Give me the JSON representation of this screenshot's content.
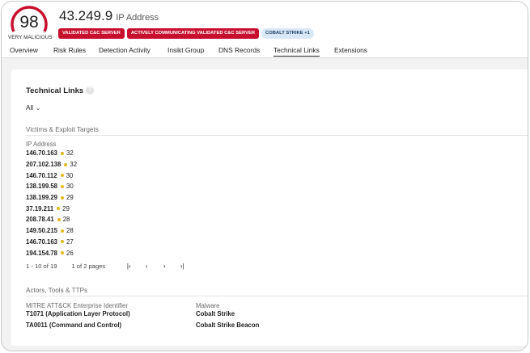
{
  "header": {
    "risk_score": "98",
    "risk_label": "VERY MALICIOUS",
    "entity_value": "43.249.9",
    "entity_type": "IP Address",
    "badges": [
      "VALIDATED C&C SERVER",
      "ACTIVELY COMMUNICATING VALIDATED C&C SERVER",
      "COBALT STRIKE +1"
    ]
  },
  "tabs": [
    "Overview",
    "Risk Rules",
    "Detection Activity",
    "Insikt Group",
    "DNS Records",
    "Technical Links",
    "Extensions"
  ],
  "active_tab": "Technical Links",
  "technical_links": {
    "title": "Technical Links",
    "filter_value": "All",
    "victims": {
      "header": "Victims & Exploit Targets",
      "column_label": "IP Address",
      "rows": [
        {
          "ip": "146.70.163",
          "score": "32"
        },
        {
          "ip": "207.102.138",
          "score": "32"
        },
        {
          "ip": "146.70.112",
          "score": "30"
        },
        {
          "ip": "138.199.58",
          "score": "30"
        },
        {
          "ip": "138.199.29",
          "score": "29"
        },
        {
          "ip": "37.19.211",
          "score": "29"
        },
        {
          "ip": "208.78.41",
          "score": "28"
        },
        {
          "ip": "149.50.215",
          "score": "28"
        },
        {
          "ip": "146.70.163",
          "score": "27"
        },
        {
          "ip": "194.154.78",
          "score": "26"
        }
      ],
      "pagination": {
        "range": "1 - 10 of 19",
        "pages": "1 of 2 pages",
        "first": "|‹",
        "prev": "‹",
        "next": "›",
        "last": "›|"
      }
    },
    "actors": {
      "header": "Actors, Tools & TTPs",
      "mitre_label": "MITRE ATT&CK Enterprise Identifier",
      "mitre_values": [
        "T1071 (Application Layer Protocol)",
        "TA0011 (Command and Control)"
      ],
      "malware_label": "Malware",
      "malware_values": [
        "Cobalt Strike",
        "Cobalt Strike Beacon"
      ]
    }
  },
  "colors": {
    "risk_red": "#c8102e",
    "badge_blue_bg": "#d9e7f7",
    "score_dot": "#e6b820"
  }
}
